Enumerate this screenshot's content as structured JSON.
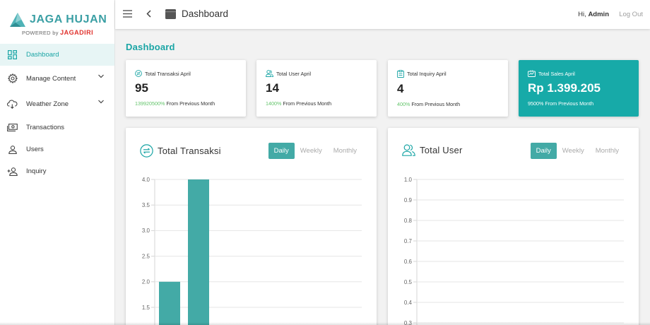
{
  "brand": {
    "name": "JAGA HUJAN",
    "powered_by": "POWERED by",
    "powered_brand": "JAGADIRI"
  },
  "sidebar": {
    "items": [
      {
        "label": "Dashboard",
        "icon": "dashboard-icon",
        "active": true
      },
      {
        "label": "Manage Content",
        "icon": "gear-icon",
        "expandable": true
      },
      {
        "label": "Weather Zone",
        "icon": "cloud-icon",
        "expandable": true
      },
      {
        "label": "Transactions",
        "icon": "cash-icon"
      },
      {
        "label": "Users",
        "icon": "user-icon"
      },
      {
        "label": "Inquiry",
        "icon": "user-add-icon"
      }
    ]
  },
  "topbar": {
    "title": "Dashboard",
    "greeting": "Hi,",
    "user": "Admin",
    "logout": "Log Out"
  },
  "page": {
    "heading": "Dashboard"
  },
  "stats": [
    {
      "label": "Total Transaksi April",
      "value": "95",
      "pct": "139920500%",
      "foot": "From Previous Month",
      "icon": "exchange-icon"
    },
    {
      "label": "Total User April",
      "value": "14",
      "pct": "1400%",
      "foot": "From Previous Month",
      "icon": "users-icon"
    },
    {
      "label": "Total Inquiry April",
      "value": "4",
      "pct": "400%",
      "foot": "From Previous Month",
      "icon": "clipboard-icon"
    },
    {
      "label": "Total Sales April",
      "value": "Rp 1.399.205",
      "pct": "9500%",
      "foot": "From Previous Month",
      "icon": "sales-icon"
    }
  ],
  "panels": [
    {
      "title": "Total Transaksi",
      "icon": "exchange-icon",
      "tabs": [
        "Daily",
        "Weekly",
        "Monthly"
      ],
      "active_tab": "Daily"
    },
    {
      "title": "Total User",
      "icon": "users-icon",
      "tabs": [
        "Daily",
        "Weekly",
        "Monthly"
      ],
      "active_tab": "Daily"
    }
  ],
  "colors": {
    "accent": "#1aa5a5",
    "bar": "#43aaa6",
    "positive": "#63c46b",
    "muted": "#a0a0a0"
  },
  "chart_data": [
    {
      "type": "bar",
      "title": "Total Transaksi",
      "yticks": [
        1.5,
        2.0,
        2.5,
        3.0,
        3.5,
        4.0
      ],
      "ylim": [
        1.5,
        4.0
      ],
      "values": [
        2.0,
        4.0
      ],
      "grid": true,
      "xlabel": "",
      "ylabel": ""
    },
    {
      "type": "bar",
      "title": "Total User",
      "yticks": [
        0.3,
        0.4,
        0.5,
        0.6,
        0.7,
        0.8,
        0.9,
        1.0
      ],
      "ylim": [
        0.3,
        1.0
      ],
      "values": [],
      "grid": true,
      "xlabel": "",
      "ylabel": ""
    }
  ]
}
